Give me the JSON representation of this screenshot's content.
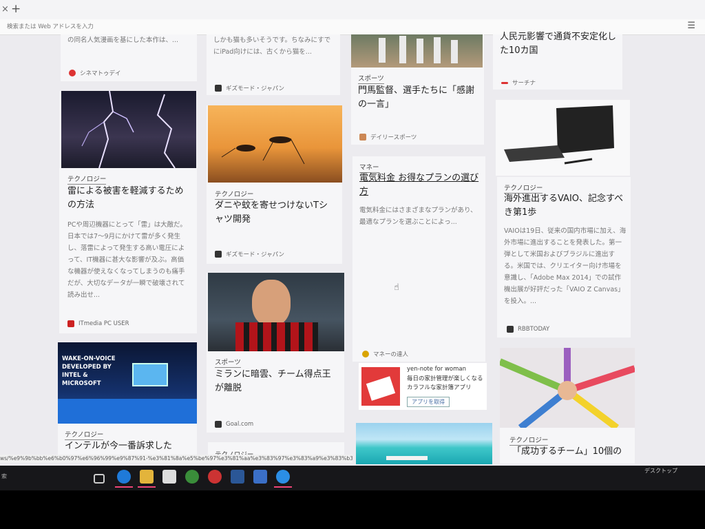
{
  "browser": {
    "address_placeholder": "検索または Web アドレスを入力",
    "new_tab_label": "+",
    "close_label": "×",
    "menu_label": "☰"
  },
  "cards": {
    "c1_top": {
      "snippet": "の同名人気漫画を基にした本作は、...",
      "source": "シネマトゥデイ"
    },
    "c1_lightning": {
      "tag": "テクノロジー",
      "title": "雷による被害を軽減するための方法",
      "body": "PCや周辺機器にとって「雷」は大敵だ。日本では7〜9月にかけて雷が多く発生し、落雷によって発生する高い電圧によって、IT機器に甚大な影響が及ぶ。高価な機器が使えなくなってしまうのも痛手だが、大切なデータが一瞬で破壊されて読み出せ...",
      "source": "ITmedia PC USER"
    },
    "c1_intel": {
      "tag": "テクノロジー",
      "title": "インテルが今一番訴求した",
      "img_text": "WAKE-ON-VOICE DEVELOPED BY INTEL & MICROSOFT"
    },
    "c2_top": {
      "snippet": "しかも猫も多いそうです。ちなみにすでにiPad向けには、古くから猫を...",
      "source": "ギズモード・ジャパン"
    },
    "c2_mosquito": {
      "tag": "テクノロジー",
      "title": "ダニや蚊を寄せつけないTシャツ開発",
      "source": "ギズモード・ジャパン"
    },
    "c2_soccer": {
      "tag": "スポーツ",
      "title": "ミランに暗雲、チーム得点王が離脱",
      "source": "Goal.com"
    },
    "c2_bottom": {
      "tag": "テクノロジー"
    },
    "c3_baseball": {
      "tag": "スポーツ",
      "title": "門馬監督、選手たちに「感謝の一言」",
      "source": "デイリースポーツ"
    },
    "c3_money": {
      "tag": "マネー",
      "title": "電気料金 お得なプランの選び方",
      "body": "電気料金にはさまざまなプランがあり、最適なプランを選ぶことによっ...",
      "source": "マネーの達人"
    },
    "c3_ad": {
      "title": "yen-note for woman",
      "body": "毎日の家計管理が楽しくなるカラフルな家計簿アプリ",
      "button": "アプリを取得"
    },
    "c4_top": {
      "snippet": "人民元影響で通貨不安定化した10カ国",
      "source": "サーチナ"
    },
    "c4_vaio": {
      "tag": "テクノロジー",
      "title": "海外進出するVAIO、記念すべき第1歩",
      "body": "VAIOは19日、従来の国内市場に加え、海外市場に進出することを発表した。第一弾として米国およびブラジルに進出する。米国では、クリエイター向け市場を意識し、「Adobe Max 2014」での試作機出展が好評だった「VAIO Z Canvas」を投入。...",
      "source": "RBBTODAY"
    },
    "c4_team": {
      "tag": "テクノロジー",
      "title": "「成功するチーム」10個の"
    }
  },
  "status_url": "ws/%e9%9b%bb%e6%b0%97%e6%96%99%e9%87%91-%e3%81%8a%e5%be%97%e3%81%aa%e3%83%97%e3%83%a9%e3%83%b3%e3%81%",
  "taskbar": {
    "desktop_label": "デスクトップ",
    "left_label": "索"
  }
}
